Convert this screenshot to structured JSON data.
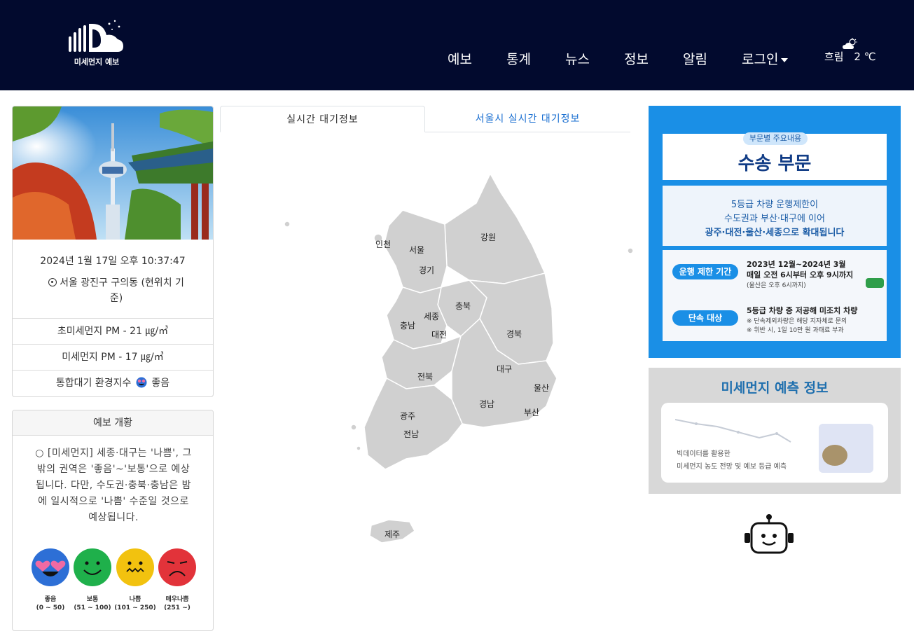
{
  "header": {
    "logo_text": "미세먼지 예보",
    "nav": [
      "예보",
      "통계",
      "뉴스",
      "정보",
      "알림",
      "로그인"
    ],
    "weather": {
      "condition": "흐림",
      "temp": "2 ℃",
      "icon": "cloudy-night-icon"
    }
  },
  "info": {
    "datetime": "2024년 1월 17일 오후 10:37:47",
    "location_line1": "서울 광진구 구의동 (현위치 기",
    "location_line2": "준)",
    "pm25": "초미세먼지 PM - 21 ㎍/㎥",
    "pm10": "미세먼지 PM - 17 ㎍/㎥",
    "cai_label": "통합대기 환경지수",
    "cai_value": "좋음"
  },
  "forecast": {
    "title": "예보 개황",
    "lines": [
      "○ [미세먼지] 세종·대구는 '나쁨', 그",
      "밖의 권역은 '좋음'~'보통'으로 예상",
      "됩니다. 다만, 수도권·충북·충남은 밤",
      "에 일시적으로 '나쁨' 수준일 것으로",
      "예상됩니다."
    ],
    "legend": [
      {
        "label": "좋음",
        "range": "(0 ~ 50)",
        "color": "#2d6fd6"
      },
      {
        "label": "보통",
        "range": "(51 ~ 100)",
        "color": "#1fb04b"
      },
      {
        "label": "나쁨",
        "range": "(101 ~ 250)",
        "color": "#f2c20f"
      },
      {
        "label": "매우나쁨",
        "range": "(251 ~)",
        "color": "#e2333a"
      }
    ]
  },
  "tabs": {
    "active": "실시간 대기정보",
    "inactive": "서울시 실시간 대기정보"
  },
  "map_regions": [
    "인천",
    "서울",
    "경기",
    "강원",
    "충북",
    "세종",
    "충남",
    "대전",
    "경북",
    "대구",
    "전북",
    "울산",
    "경남",
    "광주",
    "부산",
    "전남",
    "제주"
  ],
  "banner1": {
    "tag": "부문별 주요내용",
    "title": "수송 부문",
    "line1": "5등급 차량 운행제한이",
    "line2": "수도권과 부산·대구에 이어",
    "line3": "광주·대전·울산·세종으로 확대됩니다",
    "period_label": "운행 제한 기간",
    "period_line1": "2023년 12월~2024년 3월",
    "period_line2": "매일 오전 6시부터 오후 9시까지",
    "period_note": "(울산은 오후 6시까지)",
    "target_label": "단속 대상",
    "target_line1": "5등급 차량 중 저공해 미조치 차량",
    "target_note1": "※ 단속제외차량은 해당 지자체로 문의",
    "target_note2": "※ 위반 시, 1일 10만 원 과태료 부과"
  },
  "banner2": {
    "title": "미세먼지 예측 정보",
    "line1": "빅데이터를 활용한",
    "line2": "미세먼지 농도 전망 및 예보 등급 예측"
  }
}
